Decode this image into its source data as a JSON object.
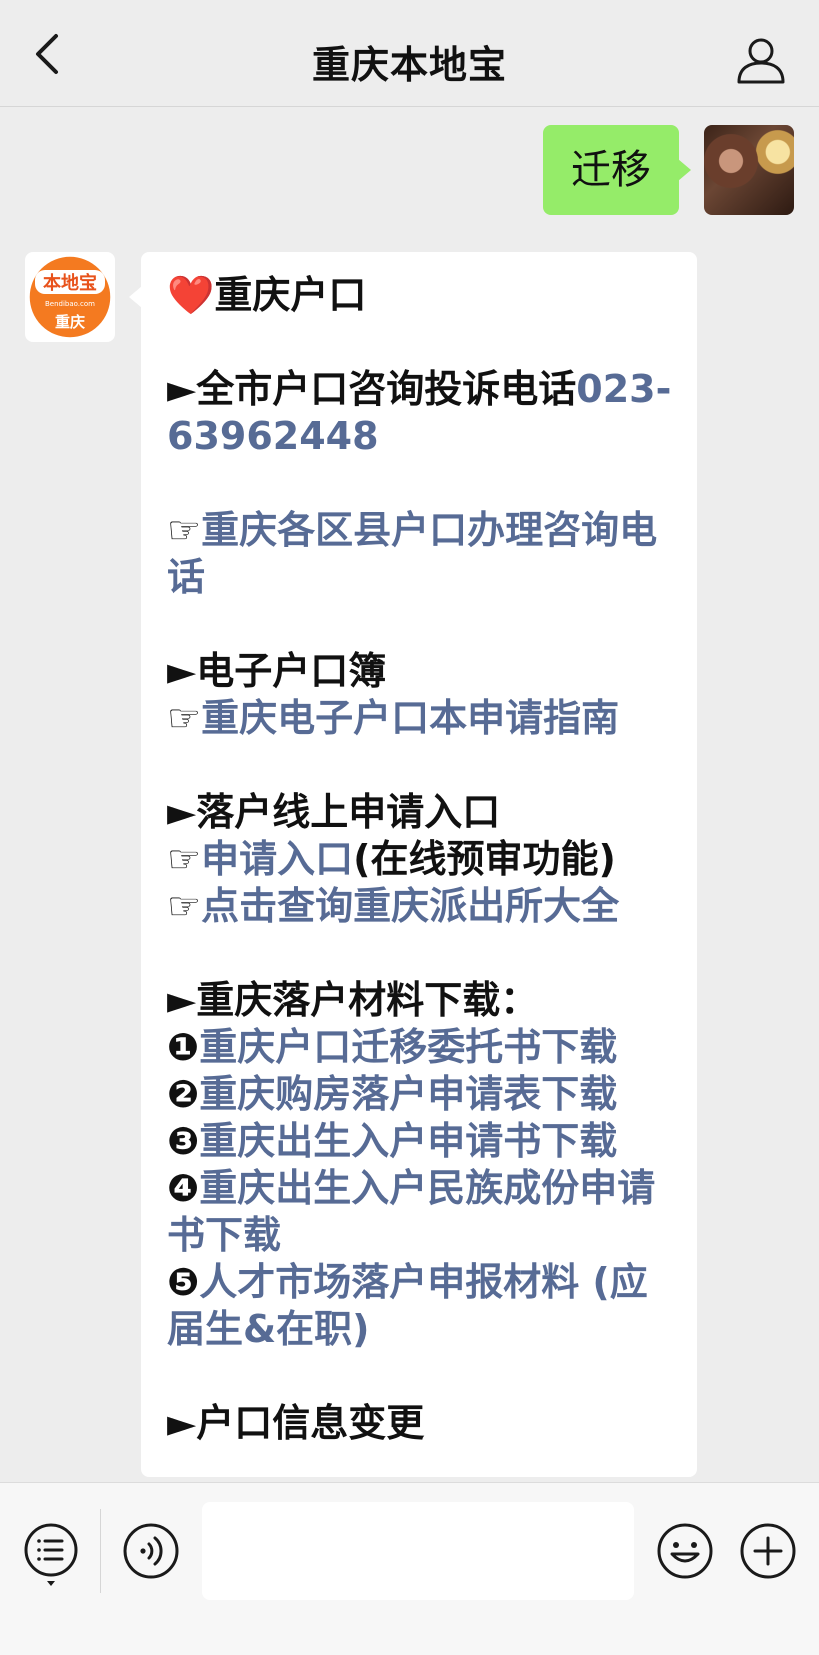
{
  "header": {
    "title": "重庆本地宝",
    "back_icon": "chevron-left-icon",
    "profile_icon": "person-icon"
  },
  "outgoing": {
    "text": "迁移",
    "bubble_color": "#95ec69"
  },
  "incoming": {
    "avatar": {
      "logo_top": "本地宝",
      "logo_url": "Bendibao.com",
      "logo_city": "重庆",
      "brand_color": "#f47a20"
    },
    "heading": {
      "icon": "❤️",
      "text": "重庆户口"
    },
    "section1": {
      "bullet": "►",
      "label": "全市户口咨询投诉电话",
      "phone": "023-63962448"
    },
    "district_link": {
      "hand": "☞",
      "text": "重庆各区县户口办理咨询电话"
    },
    "section2": {
      "bullet": "►",
      "label": "电子户口簿",
      "link": {
        "hand": "☞",
        "text": "重庆电子户口本申请指南"
      }
    },
    "section3": {
      "bullet": "►",
      "label": "落户线上申请入口",
      "apply_link": {
        "hand": "☞",
        "text": "申请入口",
        "suffix": "(在线预审功能)"
      },
      "police_link": {
        "hand": "☞",
        "text": "点击查询重庆派出所大全"
      }
    },
    "section4": {
      "bullet": "►",
      "label": "重庆落户材料下载：",
      "items": [
        {
          "num": "❶",
          "text": "重庆户口迁移委托书下载"
        },
        {
          "num": "❷",
          "text": "重庆购房落户申请表下载"
        },
        {
          "num": "❸",
          "text": "重庆出生入户申请书下载"
        },
        {
          "num": "❹",
          "text": "重庆出生入户民族成份申请书下载"
        },
        {
          "num": "❺",
          "text": "人才市场落户申报材料 (应届生&在职)"
        }
      ]
    },
    "section5": {
      "bullet": "►",
      "label": "户口信息变更"
    },
    "link_color": "#576b95"
  },
  "footer": {
    "menu_icon": "list-menu-icon",
    "voice_icon": "voice-icon",
    "emoji_icon": "smiley-icon",
    "plus_icon": "plus-circle-icon",
    "input_placeholder": ""
  }
}
